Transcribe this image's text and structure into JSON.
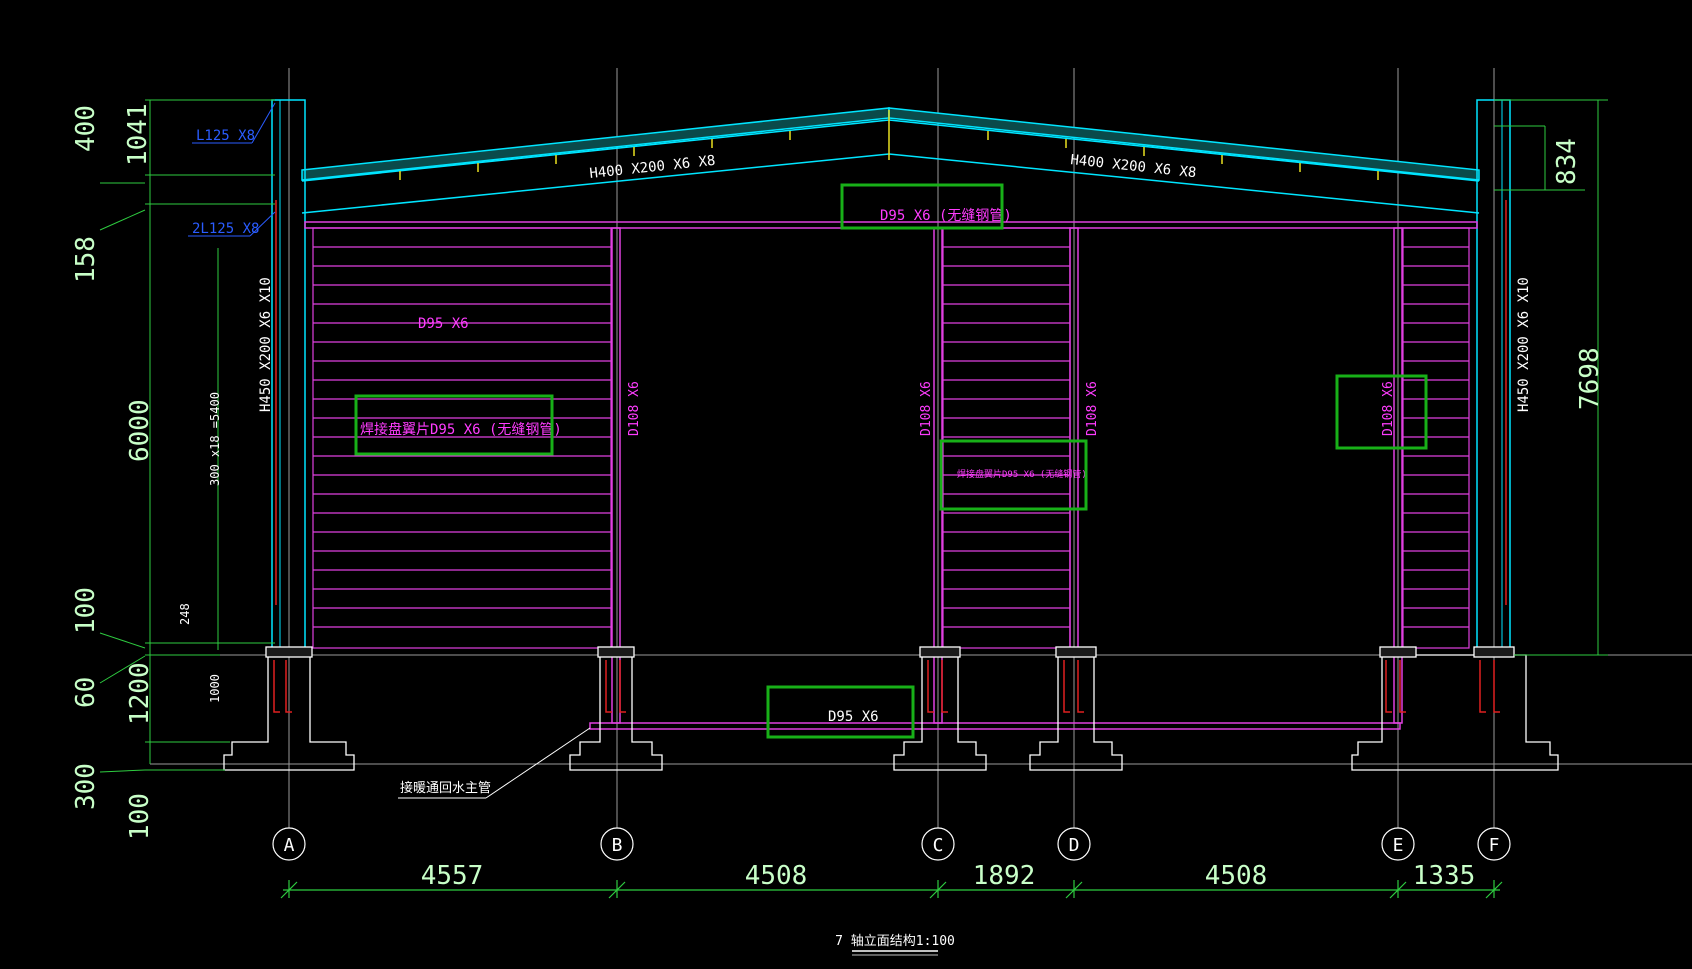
{
  "colors": {
    "background": "#000000",
    "frame": "#00e5ff",
    "structure": "#e040e0",
    "dimension": "#2ecc40",
    "highlight": "#18b018",
    "rebar": "#e02020",
    "blue_label": "#2a5cff",
    "gridline": "#b0b0b0",
    "yellow": "#e8e020"
  },
  "drawing_title": "7 轴立面结构1:100",
  "grid_axes": [
    "A",
    "B",
    "C",
    "D",
    "E",
    "F"
  ],
  "bottom_dimensions": [
    "4557",
    "4508",
    "1892",
    "4508",
    "1335"
  ],
  "left_dimensions": [
    "400",
    "1041",
    "158",
    "6000",
    "100",
    "60",
    "1200",
    "300",
    "100"
  ],
  "right_dimensions": [
    "834",
    "7698"
  ],
  "small_dims": {
    "spacing": "300 x18 =5400",
    "d248": "248",
    "d1000": "1000"
  },
  "labels": {
    "rafter_left": "H400 X200 X6 X8",
    "rafter_right": "H400 X200 X6 X8",
    "column_left": "H450 X200 X6 X10",
    "column_right": "H450 X200 X6 X10",
    "top_beam": "D95 X6 (无缝钢管)",
    "angle_1": "L125 X8",
    "angle_2": "2L125 X8",
    "d95_panel": "D95 X6",
    "panel_left": "焊接盘翼片D95 X6 (无缝钢管)",
    "panel_mid": "焊接盘翼片D95 X6 (无缝钢管)",
    "col_d108_b": "D108 X6",
    "col_d108_c": "D108 X6",
    "col_d108_d": "D108 X6",
    "col_d108_e": "D108 X6",
    "bottom_pipe": "D95 X6",
    "return_pipe": "接暖通回水主管"
  }
}
